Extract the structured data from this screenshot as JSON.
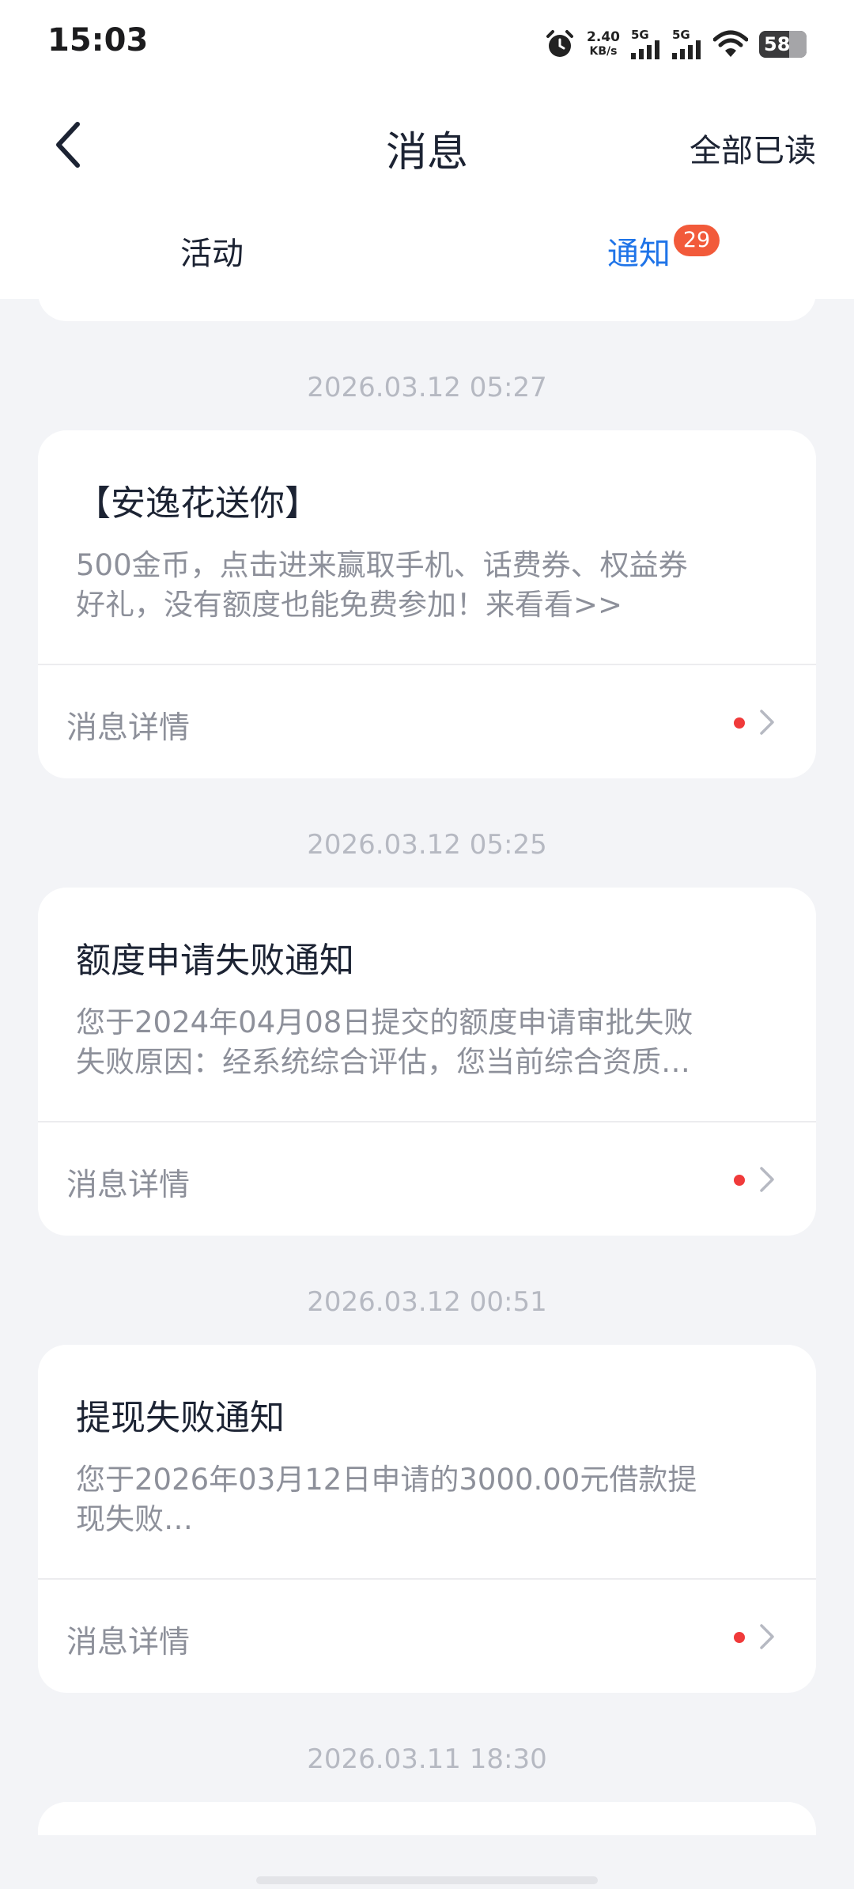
{
  "status_bar": {
    "time": "15:03",
    "net_speed_value": "2.40",
    "net_speed_unit": "KB/s",
    "sim1": "5G",
    "sim2": "5G",
    "battery": "58"
  },
  "header": {
    "title": "消息",
    "mark_all_read": "全部已读"
  },
  "tabs": {
    "activity": "活动",
    "notifications": "通知",
    "notifications_badge": "29",
    "active": "notifications"
  },
  "messages": [
    {
      "timestamp": "2026.03.12 05:27",
      "title": "【安逸花送你】",
      "body_lines": [
        "500金币，点击进来赢取手机、话费券、权益券",
        "好礼，没有额度也能免费参加！来看看>>"
      ],
      "detail_label": "消息详情",
      "unread": true
    },
    {
      "timestamp": "2026.03.12 05:25",
      "title": "额度申请失败通知",
      "body_lines": [
        "您于2024年04月08日提交的额度申请审批失败",
        "失败原因：经系统综合评估，您当前综合资质…"
      ],
      "detail_label": "消息详情",
      "unread": true
    },
    {
      "timestamp": "2026.03.12 00:51",
      "title": "提现失败通知",
      "body_lines": [
        "您于2026年03月12日申请的3000.00元借款提",
        "现失败…"
      ],
      "detail_label": "消息详情",
      "unread": true
    },
    {
      "timestamp": "2026.03.11 18:30"
    }
  ],
  "colors": {
    "accent": "#1f74e8",
    "badge": "#f25a3a",
    "unread_dot": "#f03a3a",
    "background": "#f3f4f7"
  }
}
